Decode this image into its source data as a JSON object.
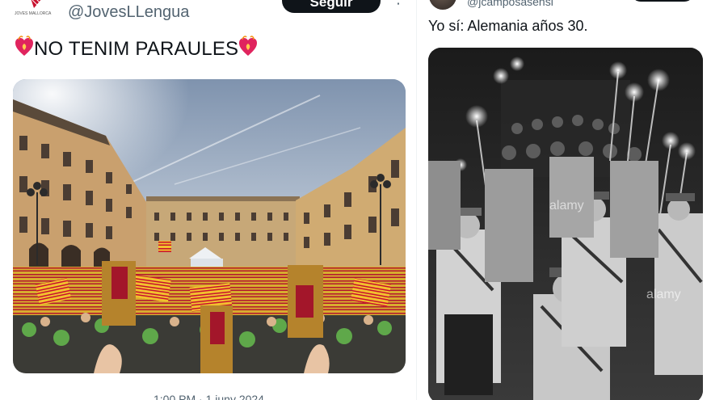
{
  "left_tweet": {
    "logo_label": "JOVES MALLORCA",
    "handle": "@JovesLLengua",
    "follow_label": "Seguir",
    "more_label": "⋮",
    "text": "NO TENIM PARAULES",
    "heart_icon": "burning-heart-icon",
    "photo_icon": "photo-plaza-rally",
    "footer_text": "1:00 PM · 1 juny 2024"
  },
  "right_tweet": {
    "handle": "@jcamposasensi",
    "text": "Yo sí: Alemania años 30.",
    "photo_icon": "photo-torch-parade",
    "watermarks": [
      "alamy",
      "alamy"
    ]
  },
  "colors": {
    "button_bg": "#0f1419",
    "handle": "#536471",
    "heart": "#e0245e",
    "flag_yellow": "#f2c12e",
    "flag_red": "#c8102e"
  }
}
